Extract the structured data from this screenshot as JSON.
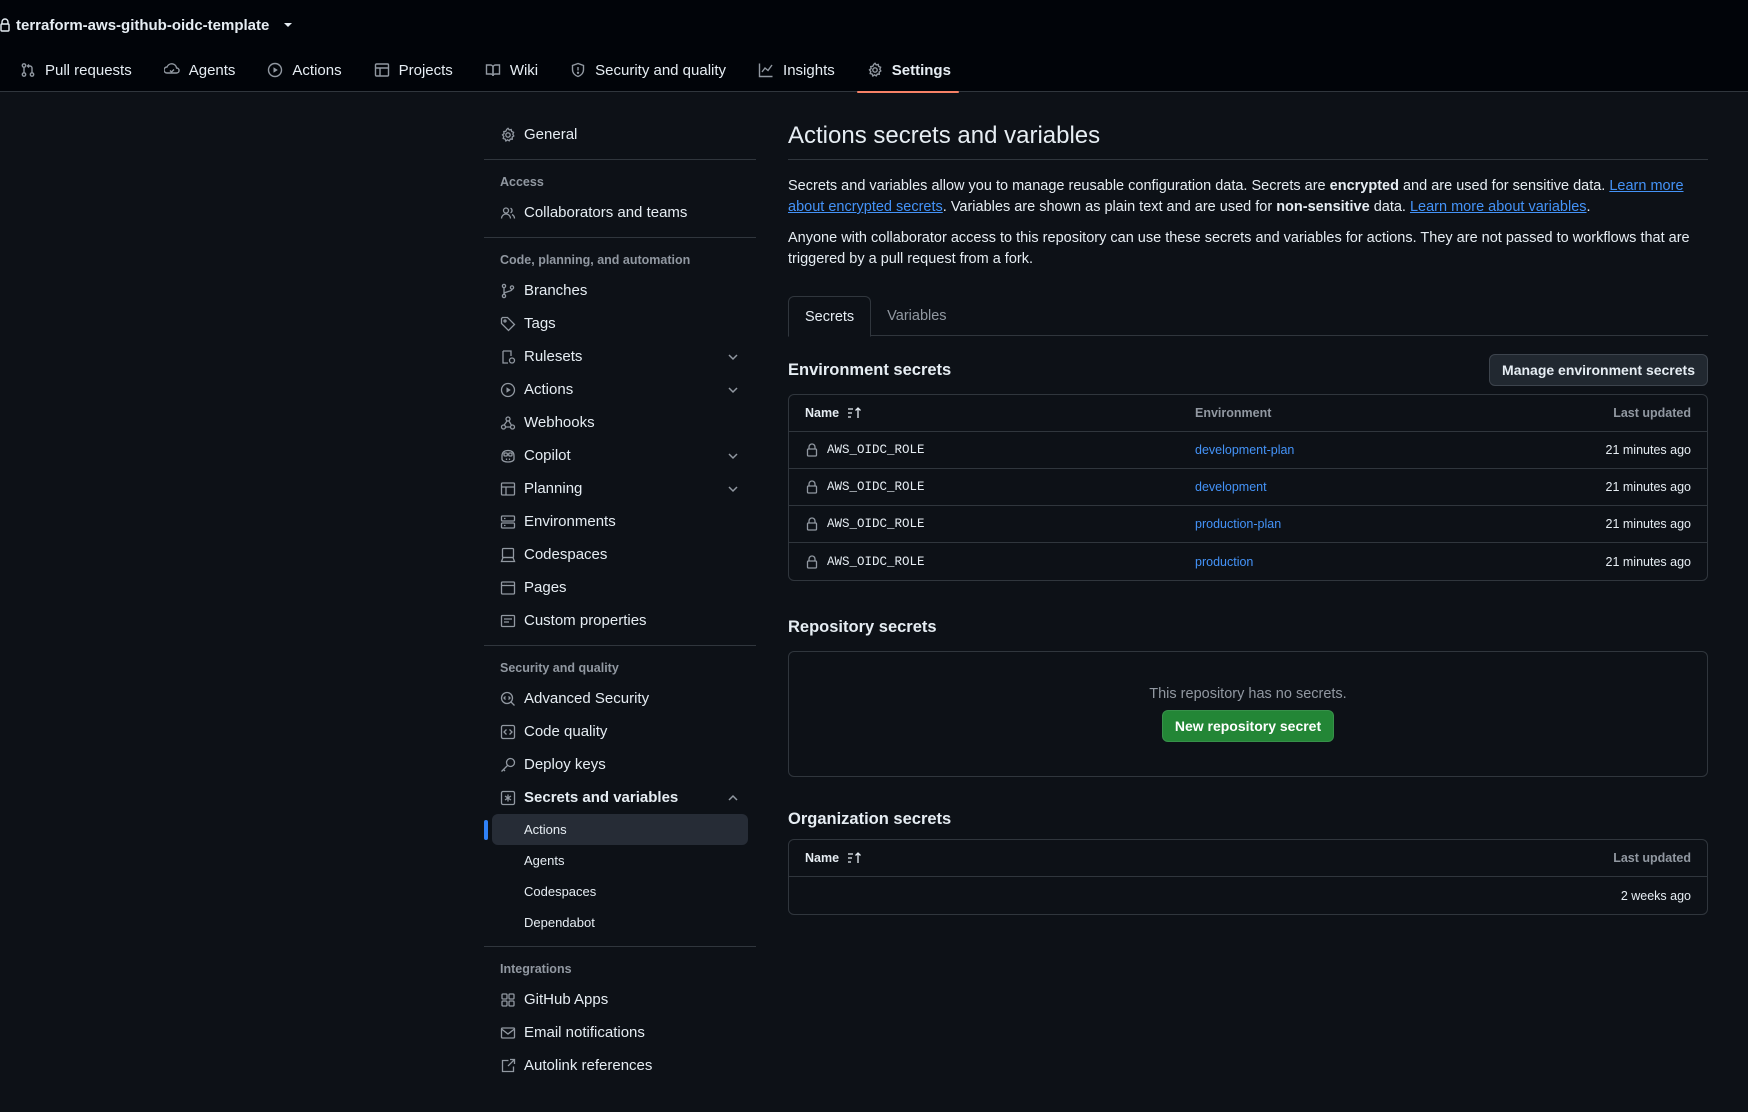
{
  "header": {
    "repo_name": "terraform-aws-github-oidc-template",
    "tabs": [
      {
        "label": "Pull requests",
        "icon": "pull-request-icon"
      },
      {
        "label": "Agents",
        "icon": "agent-icon"
      },
      {
        "label": "Actions",
        "icon": "play-icon"
      },
      {
        "label": "Projects",
        "icon": "table-icon"
      },
      {
        "label": "Wiki",
        "icon": "book-icon"
      },
      {
        "label": "Security and quality",
        "icon": "shield-icon"
      },
      {
        "label": "Insights",
        "icon": "graph-icon"
      },
      {
        "label": "Settings",
        "icon": "gear-icon",
        "active": true
      }
    ]
  },
  "sidebar": {
    "general": "General",
    "access_label": "Access",
    "collaborators": "Collaborators and teams",
    "code_label": "Code, planning, and automation",
    "branches": "Branches",
    "tags": "Tags",
    "rulesets": "Rulesets",
    "actions": "Actions",
    "webhooks": "Webhooks",
    "copilot": "Copilot",
    "planning": "Planning",
    "environments": "Environments",
    "codespaces": "Codespaces",
    "pages": "Pages",
    "custom_properties": "Custom properties",
    "security_label": "Security and quality",
    "advanced_security": "Advanced Security",
    "code_quality": "Code quality",
    "deploy_keys": "Deploy keys",
    "secrets_and_variables": "Secrets and variables",
    "sub_actions": "Actions",
    "sub_agents": "Agents",
    "sub_codespaces": "Codespaces",
    "sub_dependabot": "Dependabot",
    "integrations_label": "Integrations",
    "github_apps": "GitHub Apps",
    "email_notifications": "Email notifications",
    "autolink_references": "Autolink references"
  },
  "main": {
    "title": "Actions secrets and variables",
    "desc_part1": "Secrets and variables allow you to manage reusable configuration data. Secrets are ",
    "desc_bold1": "encrypted",
    "desc_part2": " and are used for sensitive data. ",
    "desc_link1": "Learn more about encrypted secrets",
    "desc_part3": ". Variables are shown as plain text and are used for ",
    "desc_bold2": "non-sensitive",
    "desc_part4": " data. ",
    "desc_link2": "Learn more about variables",
    "desc_part5": ".",
    "desc2": "Anyone with collaborator access to this repository can use these secrets and variables for actions. They are not passed to workflows that are triggered by a pull request from a fork.",
    "tab_secrets": "Secrets",
    "tab_variables": "Variables",
    "env_title": "Environment secrets",
    "manage_env_button": "Manage environment secrets",
    "env_table": {
      "col_name": "Name",
      "col_env": "Environment",
      "col_updated": "Last updated",
      "rows": [
        {
          "name": "AWS_OIDC_ROLE",
          "env": "development-plan",
          "updated": "21 minutes ago"
        },
        {
          "name": "AWS_OIDC_ROLE",
          "env": "development",
          "updated": "21 minutes ago"
        },
        {
          "name": "AWS_OIDC_ROLE",
          "env": "production-plan",
          "updated": "21 minutes ago"
        },
        {
          "name": "AWS_OIDC_ROLE",
          "env": "production",
          "updated": "21 minutes ago"
        }
      ]
    },
    "repo_title": "Repository secrets",
    "repo_empty": "This repository has no secrets.",
    "new_repo_secret_button": "New repository secret",
    "org_title": "Organization secrets",
    "org_table": {
      "col_name": "Name",
      "col_updated": "Last updated",
      "rows": [
        {
          "name": "",
          "updated": "2 weeks ago"
        }
      ]
    }
  },
  "colors": {
    "background": "#0d1117",
    "header_bg": "#010409",
    "border": "#30363d",
    "link": "#4493f8",
    "active_tab_underline": "#f78166",
    "active_marker": "#2f81f7",
    "green_button": "#238636"
  }
}
